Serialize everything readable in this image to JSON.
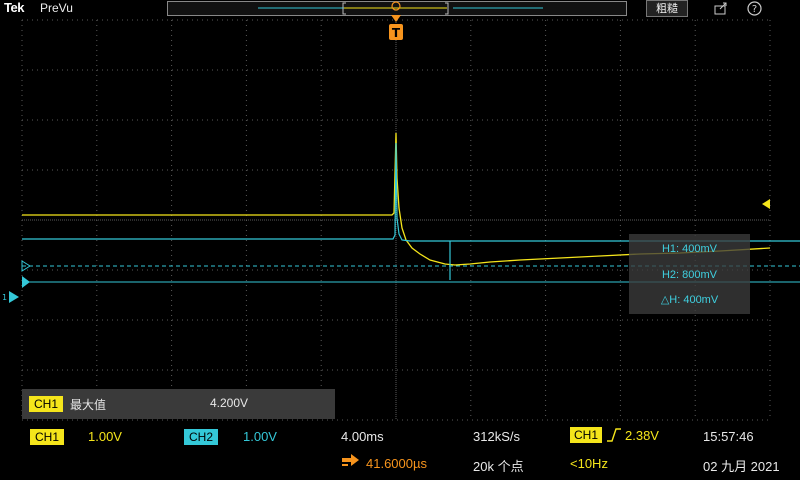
{
  "header": {
    "brand": "Tek",
    "mode": "PreVu",
    "coarse_button": "粗糙",
    "icons": [
      "export-icon",
      "help-icon"
    ]
  },
  "trigger_marker": {
    "letter": "T"
  },
  "measurements": {
    "h1": "H1: 400mV",
    "h2": "H2: 800mV",
    "dh": "△H: 400mV"
  },
  "stat": {
    "channel": "CH1",
    "name": "最大值",
    "value": "4.200V"
  },
  "status": {
    "ch1_label": "CH1",
    "ch1_scale": "1.00V",
    "ch2_label": "CH2",
    "ch2_scale": "1.00V",
    "timebase": "4.00ms",
    "sample_rate": "312kS/s",
    "record_length": "20k 个点",
    "delay": "41.6000µs",
    "trigger_source": "CH1",
    "trigger_level": "2.38V",
    "trigger_freq": "<10Hz",
    "time": "15:57:46",
    "date": "02 九月 2021"
  },
  "colors": {
    "ch1": "#f5e51b",
    "ch2": "#34c8d8",
    "trigger": "#f7941d",
    "grid": "#5a5a5a"
  }
}
